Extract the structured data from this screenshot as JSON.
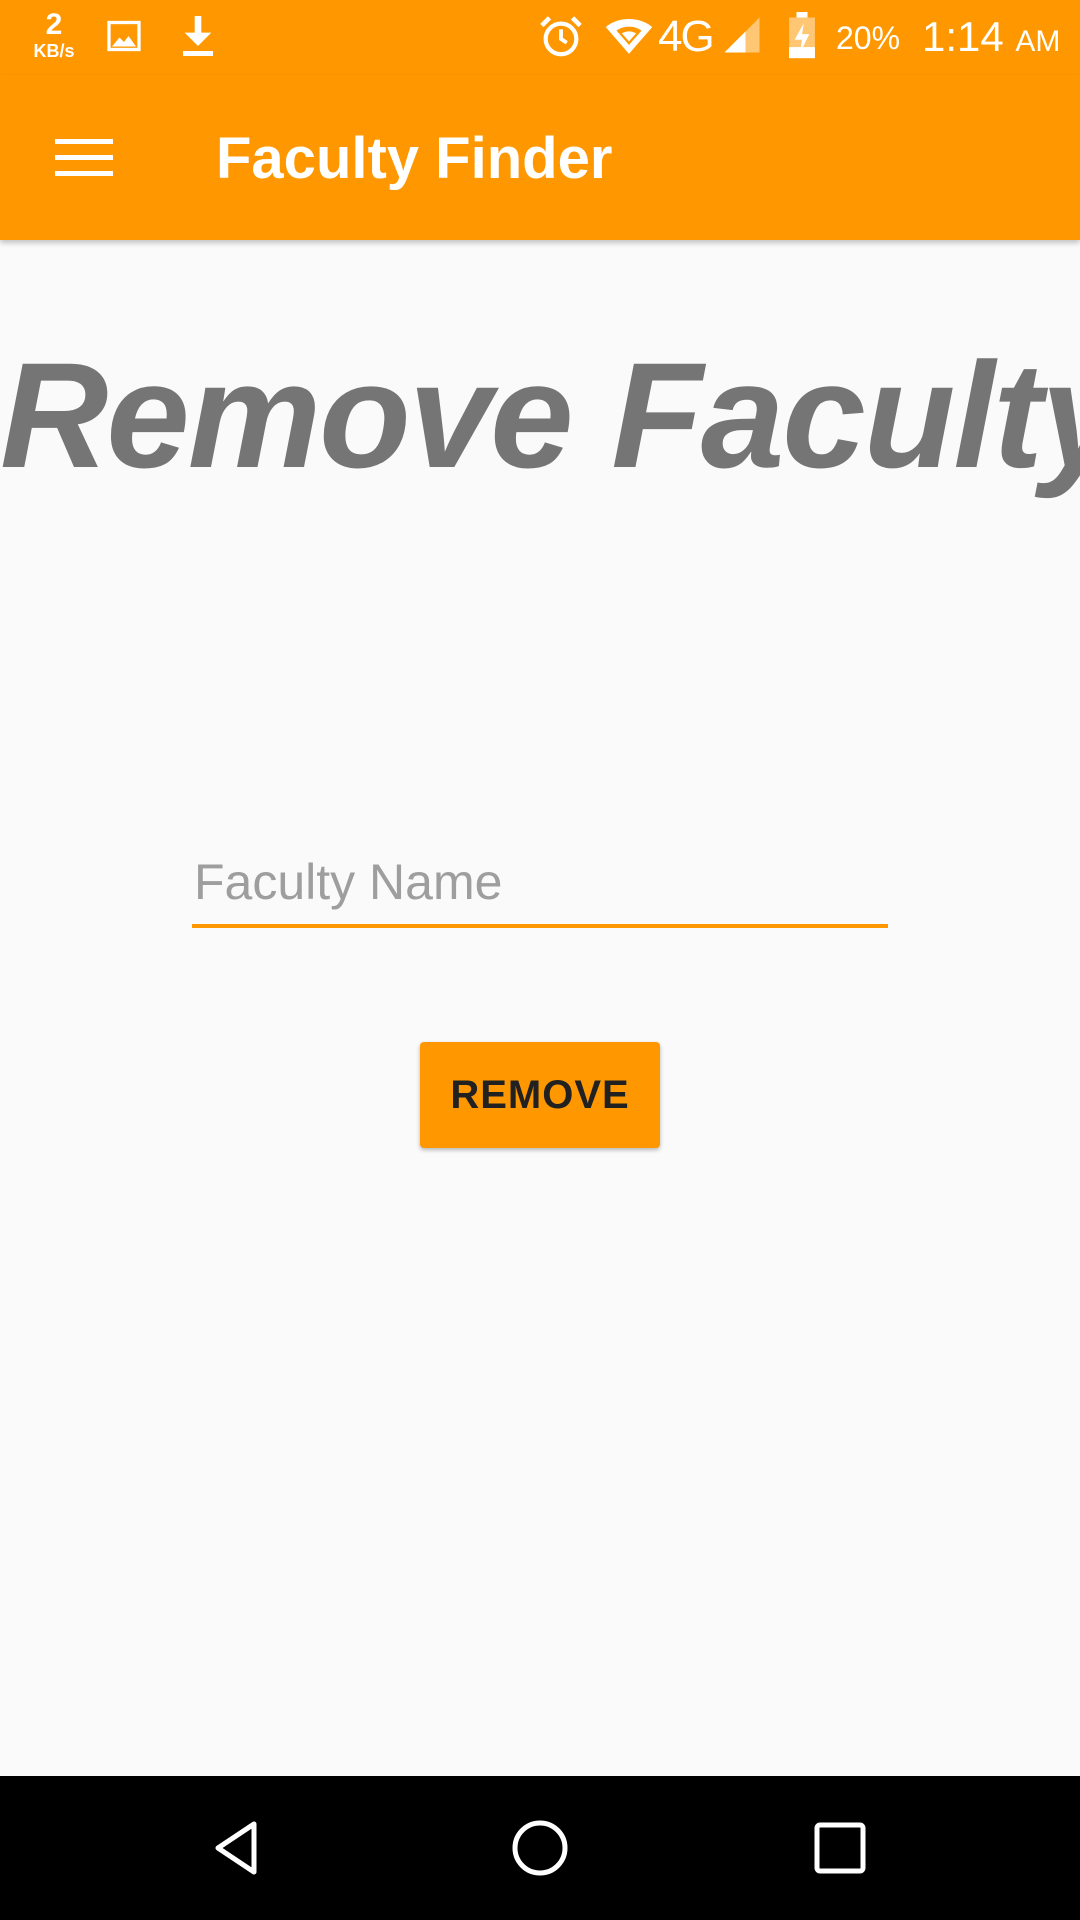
{
  "status_bar": {
    "net_speed_value": "2",
    "net_speed_unit": "KB/s",
    "network_type": "4G",
    "battery_percent": "20%",
    "time": "1:14",
    "time_period": "AM",
    "icons": [
      "gallery-icon",
      "download-icon",
      "alarm-icon",
      "wifi-icon",
      "signal-icon",
      "battery-charging-icon"
    ]
  },
  "app_bar": {
    "title": "Faculty Finder",
    "menu_icon": "menu-icon"
  },
  "main": {
    "heading": "Remove Faculty",
    "faculty_input": {
      "placeholder": "Faculty Name",
      "value": ""
    },
    "remove_label": "REMOVE"
  },
  "nav_bar": {
    "icons": [
      "back-icon",
      "home-icon",
      "recents-icon"
    ]
  },
  "colors": {
    "accent": "#ff9800",
    "heading": "#757575",
    "background": "#fafafa",
    "nav_bar": "#000000"
  }
}
